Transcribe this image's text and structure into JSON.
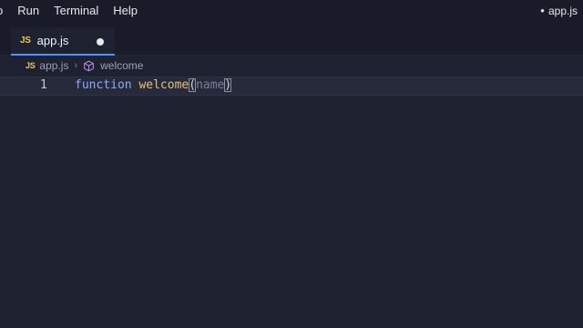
{
  "menubar": {
    "items": [
      "o",
      "Run",
      "Terminal",
      "Help"
    ],
    "window_title": "app.js"
  },
  "tabs": [
    {
      "label": "app.js",
      "icon": "js-icon",
      "badge": "JS",
      "dirty": true
    }
  ],
  "breadcrumb": {
    "file": "app.js",
    "file_badge": "JS",
    "symbol": "welcome",
    "symbol_icon": "cube-icon"
  },
  "editor": {
    "lines": [
      {
        "number": "1",
        "tokens": {
          "keyword": "function",
          "space1": " ",
          "name": "welcome",
          "open": "(",
          "param": "name",
          "close": ")"
        }
      }
    ]
  },
  "colors": {
    "background": "#1e2130",
    "accent": "#4f90ff",
    "keyword": "#8fa9ff",
    "function_name": "#e5c07b",
    "js_badge": "#e9c46a"
  }
}
